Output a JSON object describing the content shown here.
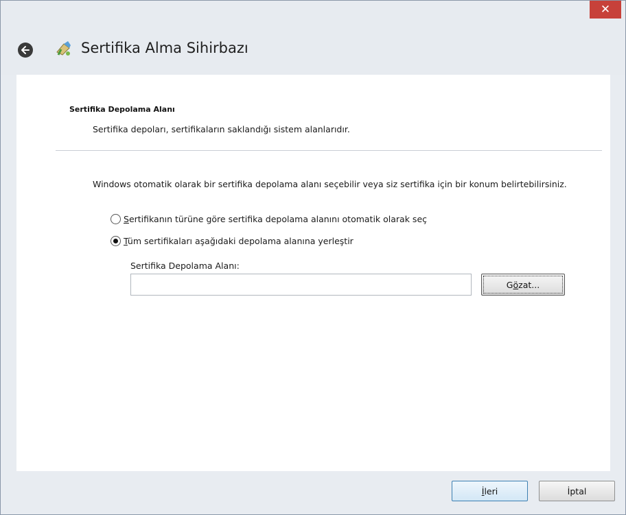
{
  "window": {
    "title": "Sertifika Alma Sihirbazı",
    "close_label": "✕"
  },
  "section": {
    "title": "Sertifika Depolama Alanı",
    "description": "Sertifika depoları, sertifikaların saklandığı sistem alanlarıdır."
  },
  "intro": "Windows otomatik olarak bir sertifika depolama alanı seçebilir veya siz sertifika için bir konum belirtebilirsiniz.",
  "options": [
    {
      "mnemonic": "S",
      "rest": "ertifikanın türüne göre sertifika depolama alanını otomatik olarak seç",
      "selected": false
    },
    {
      "mnemonic": "T",
      "rest": "üm sertifikaları aşağıdaki depolama alanına yerleştir",
      "selected": true
    }
  ],
  "store": {
    "label": "Sertifika Depolama Alanı:",
    "value": "",
    "browse_pre": "G",
    "browse_mnemonic": "ö",
    "browse_post": "zat..."
  },
  "footer": {
    "next_mnemonic": "İ",
    "next_rest": "leri",
    "cancel_label": "İptal"
  },
  "colors": {
    "close_bg": "#c7413a",
    "frame_bg": "#e7ebf0",
    "accent_border": "#3c7fb1"
  }
}
